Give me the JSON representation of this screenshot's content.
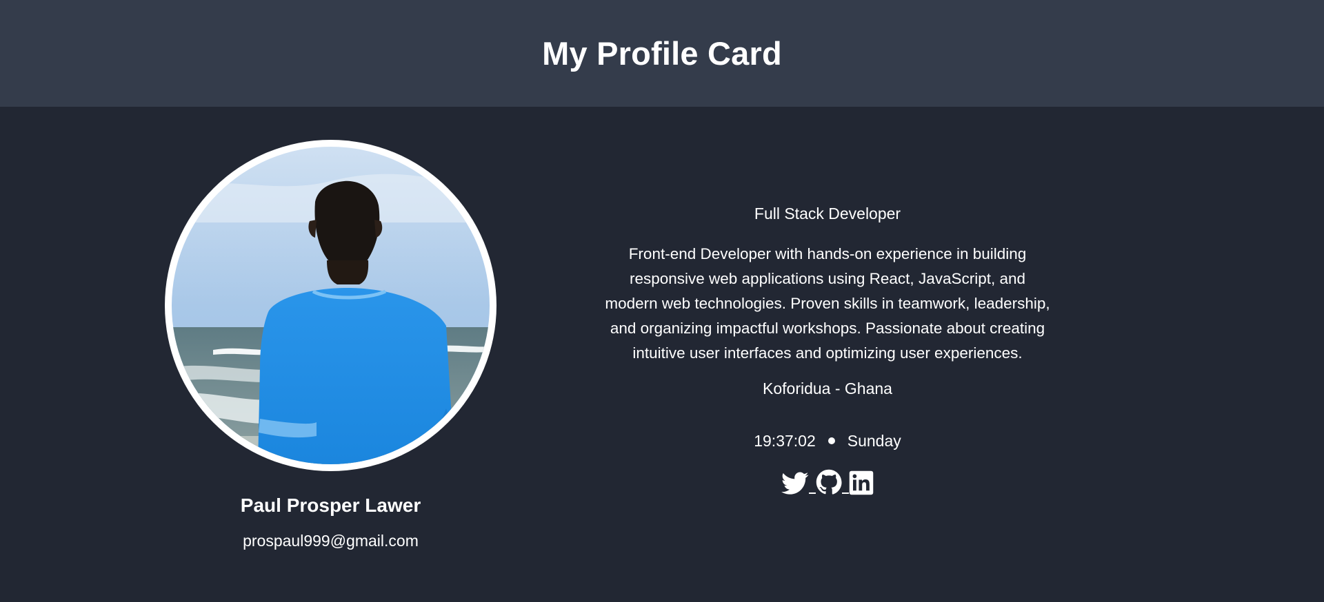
{
  "header": {
    "title": "My Profile Card"
  },
  "profile": {
    "name": "Paul Prosper Lawer",
    "email": "prospaul999@gmail.com",
    "role": "Full Stack Developer",
    "bio": "Front-end Developer with hands-on experience in building responsive web applications using React, JavaScript, and modern web technologies. Proven skills in teamwork, leadership, and organizing impactful workshops. Passionate about creating intuitive user interfaces and optimizing user experiences.",
    "location": "Koforidua - Ghana",
    "time": "19:37:02",
    "day": "Sunday"
  },
  "socials": [
    {
      "icon": "twitter-icon"
    },
    {
      "icon": "github-icon"
    },
    {
      "icon": "linkedin-icon"
    }
  ],
  "colors": {
    "header_bg": "#343c4b",
    "page_bg": "#222733",
    "text": "#ffffff"
  }
}
